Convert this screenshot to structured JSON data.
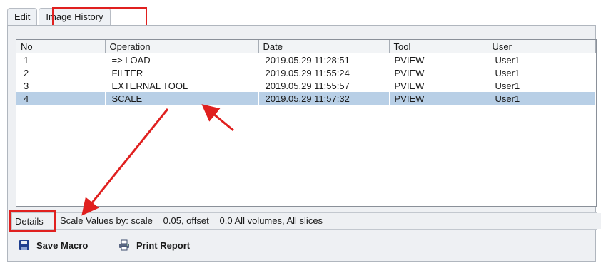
{
  "tabs": [
    {
      "label": "Edit",
      "active": false
    },
    {
      "label": "Image History",
      "active": true
    }
  ],
  "table": {
    "columns": [
      "No",
      "Operation",
      "Date",
      "Tool",
      "User"
    ],
    "rows": [
      [
        "1",
        "=> LOAD",
        "2019.05.29 11:28:51",
        "PVIEW",
        "User1"
      ],
      [
        "2",
        "FILTER",
        "2019.05.29 11:55:24",
        "PVIEW",
        "User1"
      ],
      [
        "3",
        "EXTERNAL TOOL",
        "2019.05.29 11:55:57",
        "PVIEW",
        "User1"
      ],
      [
        "4",
        "SCALE",
        "2019.05.29 11:57:32",
        "PVIEW",
        "User1"
      ]
    ],
    "selected_row": 3
  },
  "details": {
    "label": "Details",
    "text": "Scale Values by: scale = 0.05, offset = 0.0  All volumes, All slices"
  },
  "buttons": {
    "save_macro": "Save Macro",
    "print_report": "Print Report"
  },
  "icons": {
    "save": "floppy-disk-icon",
    "print": "printer-icon"
  },
  "colors": {
    "highlight": "#e0201f",
    "selection": "#b8cfe6",
    "panel": "#eef0f3"
  }
}
